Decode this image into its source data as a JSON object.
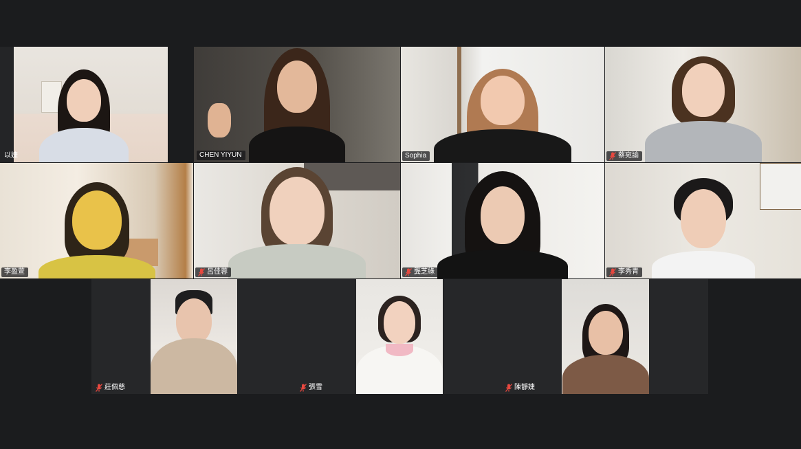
{
  "meeting": {
    "participants": [
      {
        "name": "以婕",
        "muted": false
      },
      {
        "name": "CHEN YIYUN",
        "muted": false,
        "active_speaker": true
      },
      {
        "name": "Sophia",
        "muted": false
      },
      {
        "name": "蔡宛諭",
        "muted": true
      },
      {
        "name": "李盈萱",
        "muted": false
      },
      {
        "name": "呂佳蓉",
        "muted": true
      },
      {
        "name": "龔芝綠",
        "muted": true
      },
      {
        "name": "李秀青",
        "muted": true
      },
      {
        "name": "莊佩慈",
        "muted": true
      },
      {
        "name": "張雪",
        "muted": true
      },
      {
        "name": "陳靜婕",
        "muted": true
      }
    ]
  },
  "colors": {
    "active_speaker_border": "#2dbd4e",
    "muted_icon": "#e8483f",
    "background": "#1b1c1e"
  }
}
